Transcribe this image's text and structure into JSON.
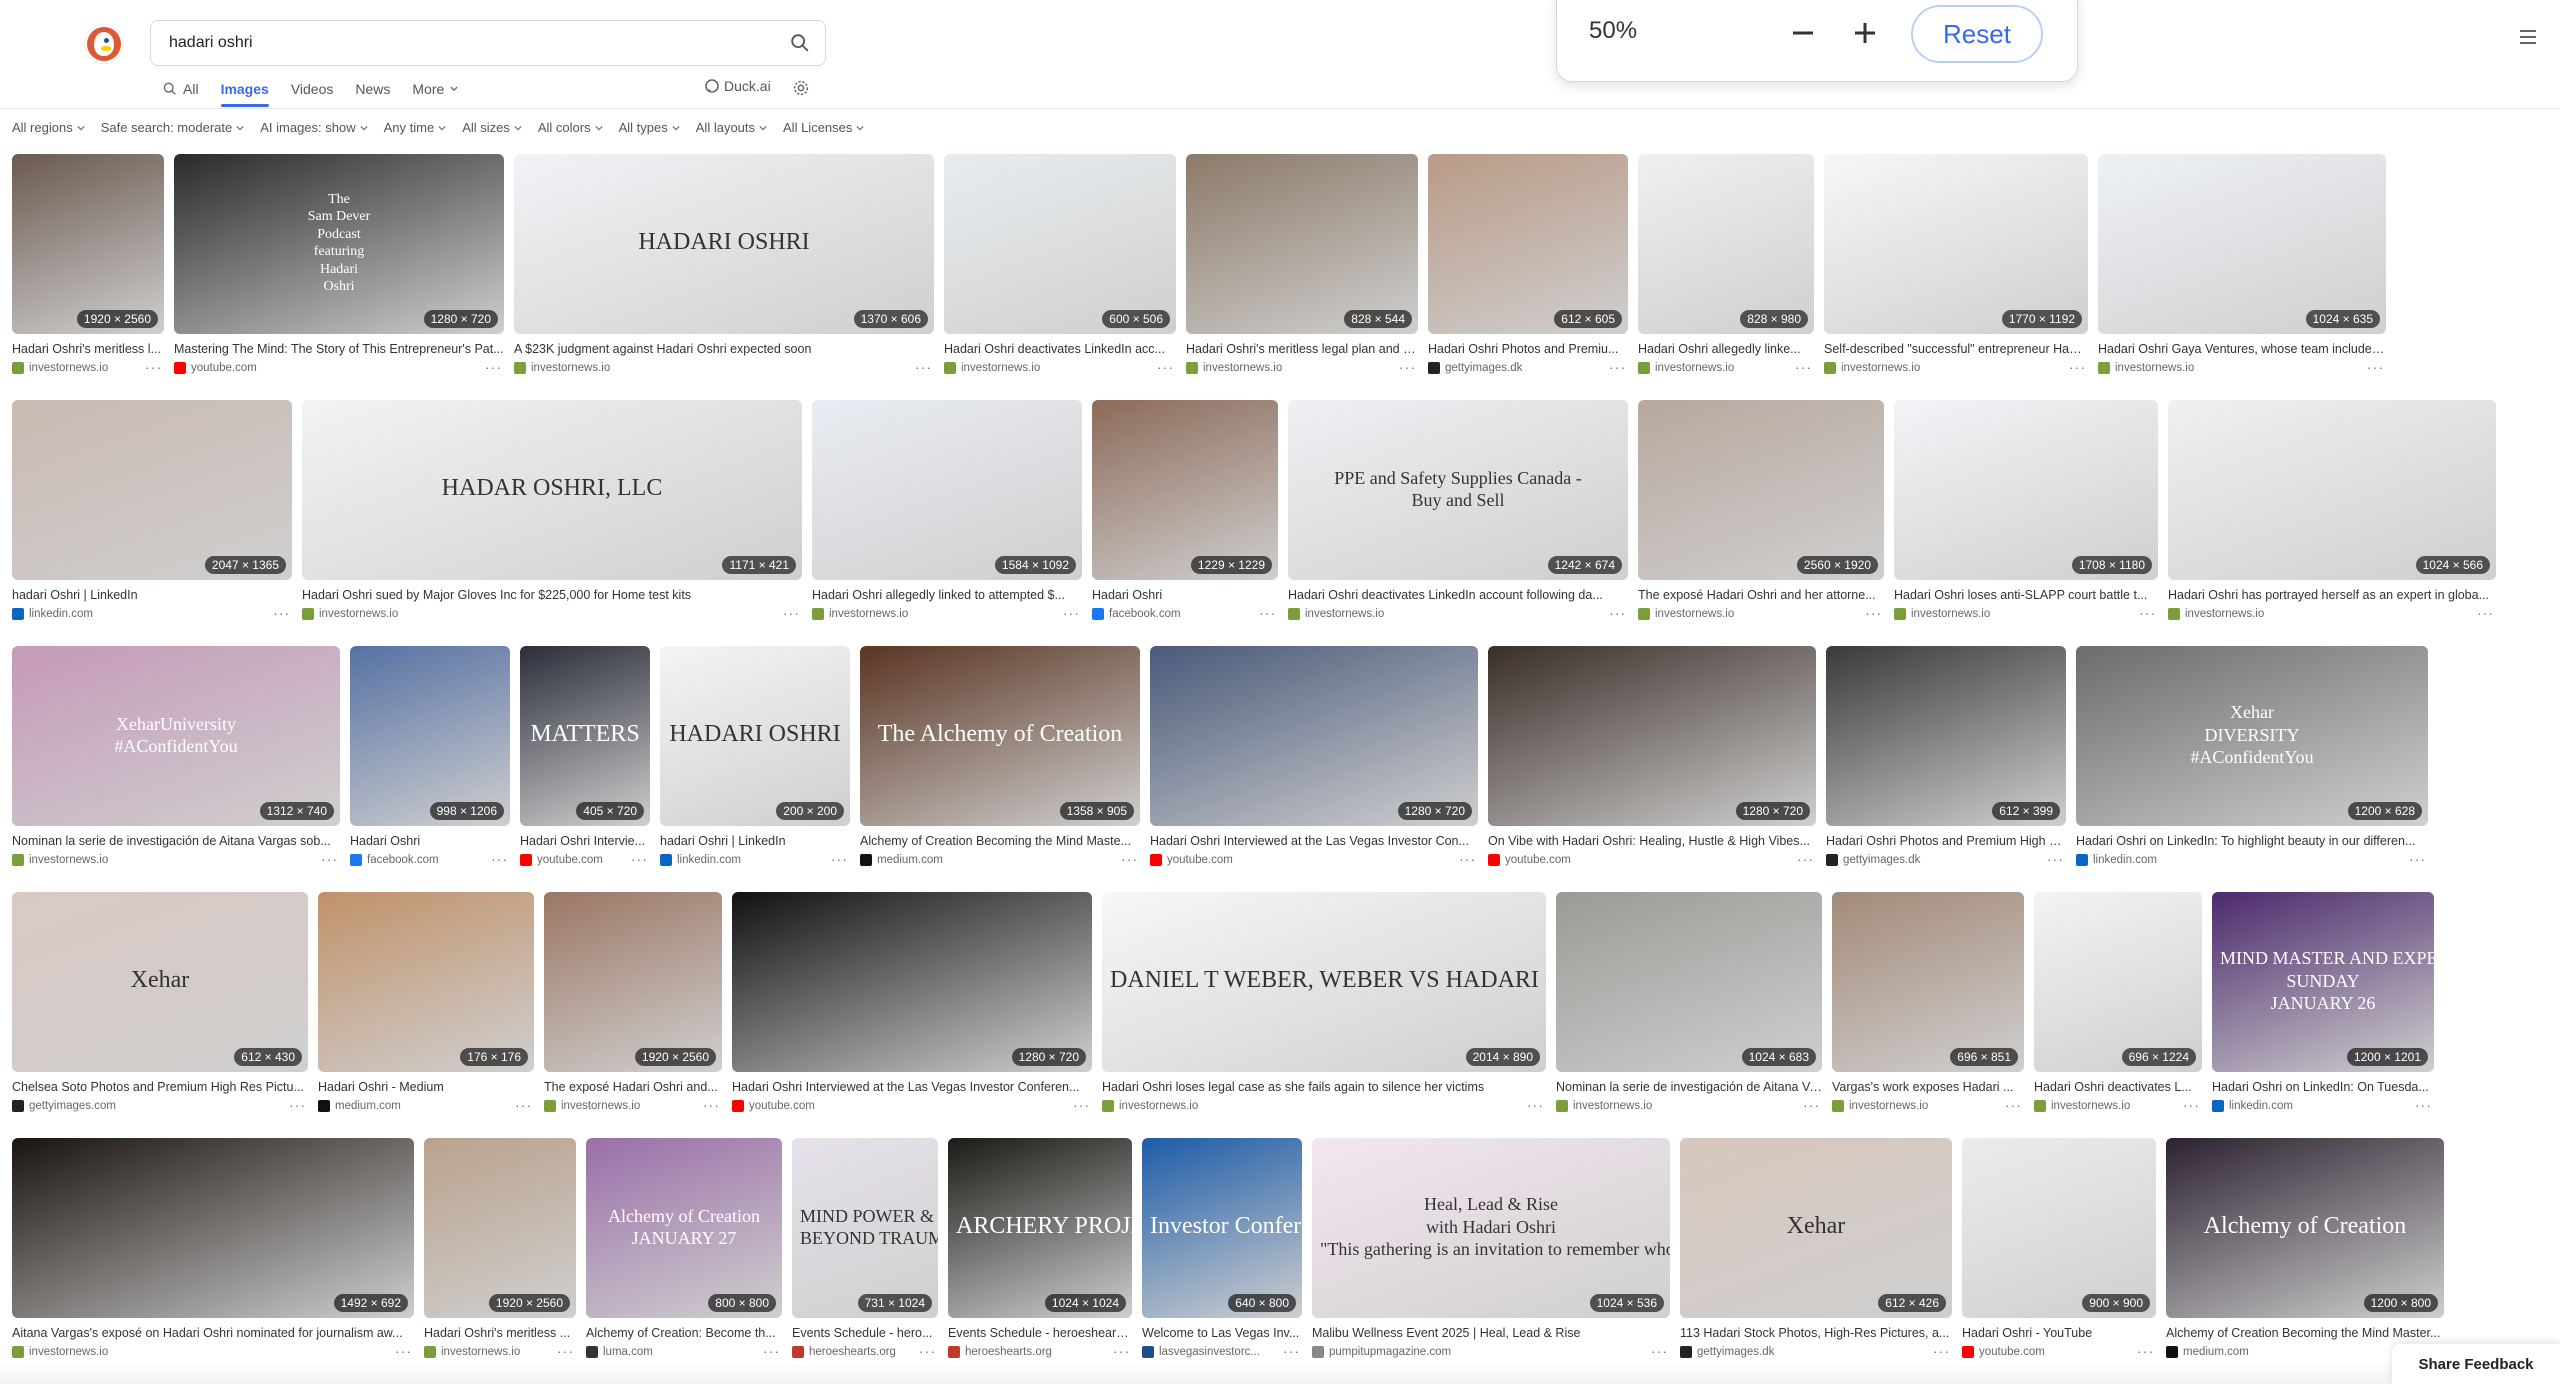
{
  "search": {
    "query": "hadari oshri"
  },
  "nav": {
    "all": "All",
    "images": "Images",
    "videos": "Videos",
    "news": "News",
    "more": "More",
    "duckai": "Duck.ai"
  },
  "zoom": {
    "value": "50%",
    "reset": "Reset"
  },
  "filters": [
    "All regions",
    "Safe search: moderate",
    "AI images: show",
    "Any time",
    "All sizes",
    "All colors",
    "All types",
    "All layouts",
    "All Licenses"
  ],
  "colors": {
    "accent": "#3969ef",
    "brand": "#de5833"
  },
  "rows": [
    [
      {
        "title": "Hadari Oshri's meritless l...",
        "source": "investornews.io",
        "dims": "1920 × 2560",
        "fav": "#7a9e3a",
        "bg": "#6b5a50",
        "w": 152
      },
      {
        "title": "Mastering The Mind: The Story of This Entrepreneur's Pat...",
        "source": "youtube.com",
        "dims": "1280 × 720",
        "fav": "#ff0000",
        "bg": "#2a2a2a",
        "w": 330,
        "overlay": [
          "The",
          "Sam Dever",
          "Podcast",
          "featuring",
          "Hadari",
          "Oshri"
        ]
      },
      {
        "title": "A $23K judgment against Hadari Oshri expected soon",
        "source": "investornews.io",
        "dims": "1370 × 606",
        "fav": "#7a9e3a",
        "bg": "#f1f3f6",
        "w": 420,
        "overlay": [
          "HADARI OSHRI"
        ]
      },
      {
        "title": "Hadari Oshri deactivates LinkedIn acc...",
        "source": "investornews.io",
        "dims": "600 × 506",
        "fav": "#7a9e3a",
        "bg": "#e8ecef",
        "w": 232
      },
      {
        "title": "Hadari Oshri's meritless legal plan and sloppy P...",
        "source": "investornews.io",
        "dims": "828 × 544",
        "fav": "#7a9e3a",
        "bg": "#8c7a68",
        "w": 232
      },
      {
        "title": "Hadari Oshri Photos and Premiu...",
        "source": "gettyimages.dk",
        "dims": "612 × 605",
        "fav": "#222222",
        "bg": "#b99a86",
        "w": 200
      },
      {
        "title": "Hadari Oshri allegedly linke...",
        "source": "investornews.io",
        "dims": "828 × 980",
        "fav": "#7a9e3a",
        "bg": "#eef0f2",
        "w": 176
      },
      {
        "title": "Self-described \"successful\" entrepreneur Hada...",
        "source": "investornews.io",
        "dims": "1770 × 1192",
        "fav": "#7a9e3a",
        "bg": "#f7f7f7",
        "w": 264
      },
      {
        "title": "Hadari Oshri Gaya Ventures, whose team includes c...",
        "source": "investornews.io",
        "dims": "1024 × 635",
        "fav": "#7a9e3a",
        "bg": "#eef1f6",
        "w": 288
      }
    ],
    [
      {
        "title": "hadari Oshri | LinkedIn",
        "source": "linkedin.com",
        "dims": "2047 × 1365",
        "fav": "#0a66c2",
        "bg": "#c9b9b1",
        "w": 280
      },
      {
        "title": "Hadari Oshri sued by Major Gloves Inc for $225,000 for Home test kits",
        "source": "investornews.io",
        "dims": "1171 × 421",
        "fav": "#7a9e3a",
        "bg": "#f3f3f3",
        "w": 500,
        "overlay": [
          "HADAR OSHRI, LLC"
        ]
      },
      {
        "title": "Hadari Oshri allegedly linked to attempted $...",
        "source": "investornews.io",
        "dims": "1584 × 1092",
        "fav": "#7a9e3a",
        "bg": "#e9ecf2",
        "w": 270
      },
      {
        "title": "Hadari Oshri",
        "source": "facebook.com",
        "dims": "1229 × 1229",
        "fav": "#1877f2",
        "bg": "#8c6b59",
        "w": 186
      },
      {
        "title": "Hadari Oshri deactivates LinkedIn account following da...",
        "source": "investornews.io",
        "dims": "1242 × 674",
        "fav": "#7a9e3a",
        "bg": "#eef0f3",
        "w": 340,
        "overlay": [
          "PPE and Safety Supplies Canada -",
          "Buy and Sell"
        ]
      },
      {
        "title": "The exposé Hadari Oshri and her attorne...",
        "source": "investornews.io",
        "dims": "2560 × 1920",
        "fav": "#7a9e3a",
        "bg": "#b8a89e",
        "w": 246
      },
      {
        "title": "Hadari Oshri loses anti-SLAPP court battle t...",
        "source": "investornews.io",
        "dims": "1708 × 1180",
        "fav": "#7a9e3a",
        "bg": "#f2f4f7",
        "w": 264
      },
      {
        "title": "Hadari Oshri has portrayed herself as an expert in globa...",
        "source": "investornews.io",
        "dims": "1024 × 566",
        "fav": "#7a9e3a",
        "bg": "#eef0f2",
        "w": 328
      }
    ],
    [
      {
        "title": "Nominan la serie de investigación de Aitana Vargas sob...",
        "source": "investornews.io",
        "dims": "1312 × 740",
        "fav": "#7a9e3a",
        "bg": "#c59ab8",
        "w": 328,
        "overlay": [
          "XeharUniversity",
          "#AConfidentYou"
        ]
      },
      {
        "title": "Hadari Oshri",
        "source": "facebook.com",
        "dims": "998 × 1206",
        "fav": "#1877f2",
        "bg": "#5671a3",
        "w": 160
      },
      {
        "title": "Hadari Oshri Intervie...",
        "source": "youtube.com",
        "dims": "405 × 720",
        "fav": "#ff0000",
        "bg": "#2b2e3a",
        "w": 130,
        "overlay": [
          "MATTERS"
        ]
      },
      {
        "title": "hadari Oshri | LinkedIn",
        "source": "linkedin.com",
        "dims": "200 × 200",
        "fav": "#0a66c2",
        "bg": "#f4f4f4",
        "w": 190,
        "overlay": [
          "HADARI OSHRI"
        ]
      },
      {
        "title": "Alchemy of Creation Becoming the Mind Maste...",
        "source": "medium.com",
        "dims": "1358 × 905",
        "fav": "#111111",
        "bg": "#5a3522",
        "w": 280,
        "overlay": [
          "The Alchemy of Creation"
        ]
      },
      {
        "title": "Hadari Oshri Interviewed at the Las Vegas Investor Con...",
        "source": "youtube.com",
        "dims": "1280 × 720",
        "fav": "#ff0000",
        "bg": "#4a5a7a",
        "w": 328
      },
      {
        "title": "On Vibe with Hadari Oshri: Healing, Hustle & High Vibes...",
        "source": "youtube.com",
        "dims": "1280 × 720",
        "fav": "#ff0000",
        "bg": "#3a2e28",
        "w": 328
      },
      {
        "title": "Hadari Oshri Photos and Premium High Res Pict...",
        "source": "gettyimages.dk",
        "dims": "612 × 399",
        "fav": "#222222",
        "bg": "#3a3a3a",
        "w": 240
      },
      {
        "title": "Hadari Oshri on LinkedIn: To highlight beauty in our differen...",
        "source": "linkedin.com",
        "dims": "1200 × 628",
        "fav": "#0a66c2",
        "bg": "#6c6c6c",
        "w": 352,
        "overlay": [
          "Xehar",
          "DIVERSITY",
          "#AConfidentYou"
        ]
      }
    ],
    [
      {
        "title": "Chelsea Soto Photos and Premium High Res Pictu...",
        "source": "gettyimages.com",
        "dims": "612 × 430",
        "fav": "#222222",
        "bg": "#d9c9c3",
        "w": 296,
        "overlay": [
          "Xehar"
        ]
      },
      {
        "title": "Hadari Oshri - Medium",
        "source": "medium.com",
        "dims": "176 × 176",
        "fav": "#111111",
        "bg": "#c0926a",
        "w": 216
      },
      {
        "title": "The exposé Hadari Oshri and...",
        "source": "investornews.io",
        "dims": "1920 × 2560",
        "fav": "#7a9e3a",
        "bg": "#9b7764",
        "w": 178
      },
      {
        "title": "Hadari Oshri Interviewed at the Las Vegas Investor Conferen...",
        "source": "youtube.com",
        "dims": "1280 × 720",
        "fav": "#ff0000",
        "bg": "#111111",
        "w": 360
      },
      {
        "title": "Hadari Oshri loses legal case as she fails again to silence her victims",
        "source": "investornews.io",
        "dims": "2014 × 890",
        "fav": "#7a9e3a",
        "bg": "#f6f7f9",
        "w": 444,
        "overlay": [
          "DANIEL T WEBER, WEBER VS HADARI OSHRI"
        ]
      },
      {
        "title": "Nominan la serie de investigación de Aitana Vargas ...",
        "source": "investornews.io",
        "dims": "1024 × 683",
        "fav": "#7a9e3a",
        "bg": "#9a9a96",
        "w": 266
      },
      {
        "title": "Vargas's work exposes Hadari ...",
        "source": "investornews.io",
        "dims": "696 × 851",
        "fav": "#7a9e3a",
        "bg": "#a38a78",
        "w": 192
      },
      {
        "title": "Hadari Oshri deactivates L...",
        "source": "investornews.io",
        "dims": "696 × 1224",
        "fav": "#7a9e3a",
        "bg": "#f2f3f5",
        "w": 168
      },
      {
        "title": "Hadari Oshri on LinkedIn: On Tuesda...",
        "source": "linkedin.com",
        "dims": "1200 × 1201",
        "fav": "#0a66c2",
        "bg": "#4b2a6c",
        "w": 222,
        "overlay": [
          "MIND MASTER AND EXPERT",
          "SUNDAY",
          "JANUARY 26"
        ]
      }
    ],
    [
      {
        "title": "Aitana Vargas's exposé on Hadari Oshri nominated for journalism aw...",
        "source": "investornews.io",
        "dims": "1492 × 692",
        "fav": "#7a9e3a",
        "bg": "#1a1410",
        "w": 402
      },
      {
        "title": "Hadari Oshri's meritless ...",
        "source": "investornews.io",
        "dims": "1920 × 2560",
        "fav": "#7a9e3a",
        "bg": "#b9a28c",
        "w": 152
      },
      {
        "title": "Alchemy of Creation: Become th...",
        "source": "luma.com",
        "dims": "800 × 800",
        "fav": "#333333",
        "bg": "#9a6fa8",
        "w": 196,
        "overlay": [
          "Alchemy of Creation",
          "JANUARY 27"
        ]
      },
      {
        "title": "Events Schedule - hero...",
        "source": "heroeshearts.org",
        "dims": "731 × 1024",
        "fav": "#c0392b",
        "bg": "#e6e1ea",
        "w": 146,
        "overlay": [
          "MIND POWER & RISING",
          "BEYOND TRAUMA"
        ]
      },
      {
        "title": "Events Schedule - heroeshearts...",
        "source": "heroeshearts.org",
        "dims": "1024 × 1024",
        "fav": "#c0392b",
        "bg": "#1c1a16",
        "w": 184,
        "overlay": [
          "ARCHERY PROJECT"
        ]
      },
      {
        "title": "Welcome to Las Vegas Inv...",
        "source": "lasvegasinvestorc...",
        "dims": "640 × 800",
        "fav": "#1b4f8a",
        "bg": "#1d5ca8",
        "w": 160,
        "overlay": [
          "Investor Conference"
        ]
      },
      {
        "title": "Malibu Wellness Event 2025 | Heal, Lead & Rise",
        "source": "pumpitupmagazine.com",
        "dims": "1024 × 536",
        "fav": "#888888",
        "bg": "#f3e6f0",
        "w": 358,
        "overlay": [
          "Heal, Lead & Rise",
          "with Hadari Oshri",
          "\"This gathering is an invitation to remember who you are at your core.\""
        ]
      },
      {
        "title": "113 Hadari Stock Photos, High-Res Pictures, a...",
        "source": "gettyimages.dk",
        "dims": "612 × 426",
        "fav": "#222222",
        "bg": "#d8c7bd",
        "w": 272,
        "overlay": [
          "Xehar"
        ]
      },
      {
        "title": "Hadari Oshri - YouTube",
        "source": "youtube.com",
        "dims": "900 × 900",
        "fav": "#ff0000",
        "bg": "#ececec",
        "w": 194
      },
      {
        "title": "Alchemy of Creation Becoming the Mind Master...",
        "source": "medium.com",
        "dims": "1200 × 800",
        "fav": "#111111",
        "bg": "#2c2230",
        "w": 278,
        "overlay": [
          "Alchemy of Creation"
        ]
      }
    ]
  ],
  "feedback": "Share Feedback"
}
